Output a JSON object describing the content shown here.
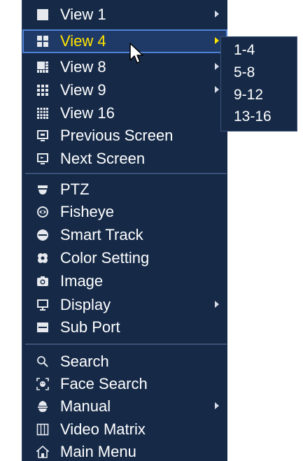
{
  "menu": {
    "items": [
      {
        "label": "View 1",
        "icon": "single-view-icon",
        "submenu": true
      },
      {
        "label": "View 4",
        "icon": "quad-view-icon",
        "submenu": true,
        "selected": true
      },
      {
        "label": "View 8",
        "icon": "eight-view-icon",
        "submenu": true
      },
      {
        "label": "View 9",
        "icon": "nine-view-icon",
        "submenu": true
      },
      {
        "label": "View 16",
        "icon": "sixteen-view-icon",
        "submenu": false
      },
      {
        "label": "Previous Screen",
        "icon": "previous-screen-icon",
        "submenu": false
      },
      {
        "label": "Next Screen",
        "icon": "next-screen-icon",
        "submenu": false
      },
      {
        "label": "PTZ",
        "icon": "ptz-camera-icon",
        "submenu": false
      },
      {
        "label": "Fisheye",
        "icon": "fisheye-icon",
        "submenu": false
      },
      {
        "label": "Smart Track",
        "icon": "smart-track-icon",
        "submenu": false
      },
      {
        "label": "Color Setting",
        "icon": "color-setting-icon",
        "submenu": false
      },
      {
        "label": "Image",
        "icon": "camera-image-icon",
        "submenu": false
      },
      {
        "label": "Display",
        "icon": "display-monitor-icon",
        "submenu": true
      },
      {
        "label": "Sub Port",
        "icon": "sub-port-icon",
        "submenu": false
      },
      {
        "label": "Search",
        "icon": "search-icon",
        "submenu": false
      },
      {
        "label": "Face Search",
        "icon": "face-search-icon",
        "submenu": false
      },
      {
        "label": "Manual",
        "icon": "manual-icon",
        "submenu": true
      },
      {
        "label": "Video Matrix",
        "icon": "video-matrix-icon",
        "submenu": false
      },
      {
        "label": "Main Menu",
        "icon": "home-icon",
        "submenu": false
      }
    ]
  },
  "submenu": {
    "items": [
      "1-4",
      "5-8",
      "9-12",
      "13-16"
    ]
  },
  "colors": {
    "menu_background": "#162a48",
    "selected_text": "#ffe300",
    "selected_border": "#4f82d6",
    "text": "#ffffff"
  }
}
